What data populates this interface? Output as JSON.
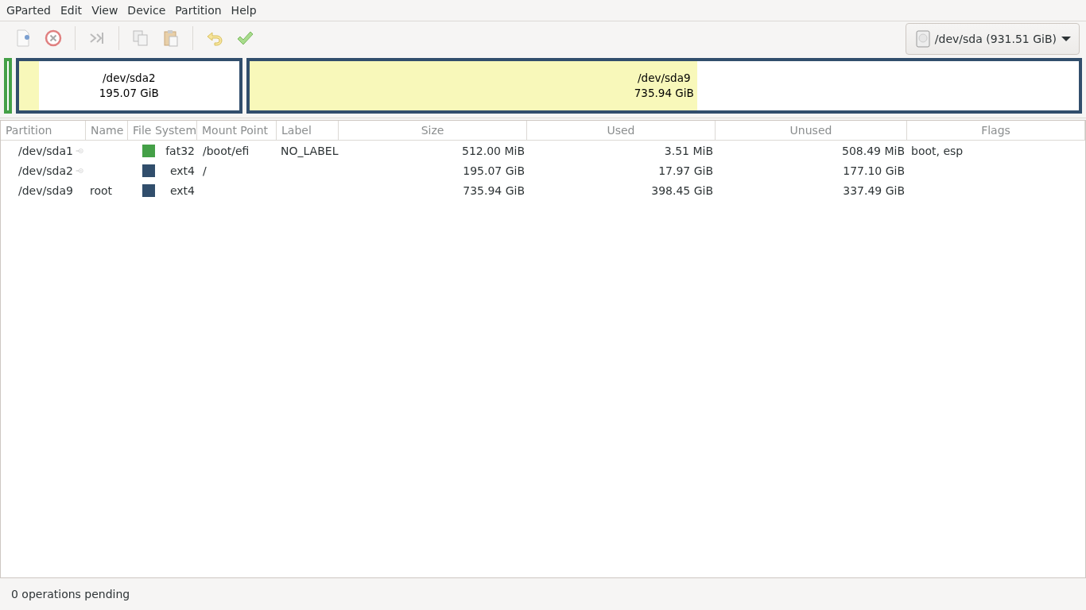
{
  "menu": [
    "GParted",
    "Edit",
    "View",
    "Device",
    "Partition",
    "Help"
  ],
  "device": {
    "label": "/dev/sda (931.51 GiB)"
  },
  "columns": [
    "Partition",
    "Name",
    "File System",
    "Mount Point",
    "Label",
    "Size",
    "Used",
    "Unused",
    "Flags"
  ],
  "partitions": [
    {
      "partition": "/dev/sda1",
      "mounted": true,
      "color": "#44a047",
      "file_system": "fat32",
      "mount_point": "/boot/efi",
      "label": "NO_LABEL",
      "size": "512.00 MiB",
      "used": "3.51 MiB",
      "unused": "508.49 MiB",
      "flags": "boot, esp"
    },
    {
      "partition": "/dev/sda2",
      "mounted": true,
      "color": "#314e6c",
      "file_system": "ext4",
      "mount_point": "/",
      "size": "195.07 GiB",
      "used": "17.97 GiB",
      "unused": "177.10 GiB",
      "level": 0.092,
      "map_name": "/dev/sda2",
      "map_size": "195.07 GiB"
    },
    {
      "partition": "/dev/sda9",
      "mounted": false,
      "name": "root",
      "color": "#314e6c",
      "file_system": "ext4",
      "size": "735.94 GiB",
      "used": "398.45 GiB",
      "unused": "337.49 GiB",
      "level": 0.54,
      "map_name": "/dev/sda9",
      "map_size": "735.94 GiB"
    }
  ],
  "status": "0 operations pending"
}
